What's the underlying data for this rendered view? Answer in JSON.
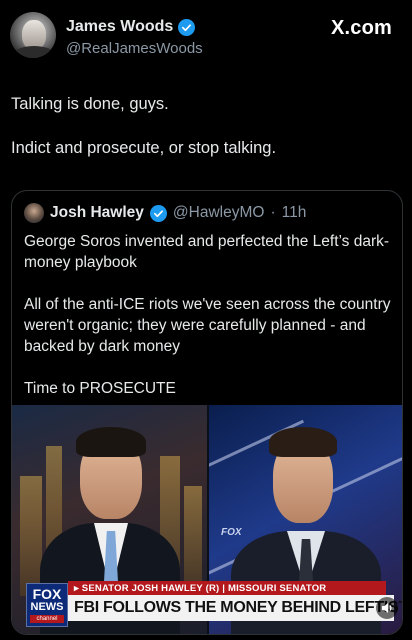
{
  "author": {
    "name": "James Woods",
    "handle": "@RealJamesWoods"
  },
  "brand": {
    "label": "X.com"
  },
  "tweet": {
    "lines": [
      "Talking is done, guys.",
      "Indict and prosecute, or stop talking."
    ]
  },
  "quote": {
    "name": "Josh Hawley",
    "handle": "@HawleyMO",
    "separator": "·",
    "time": "11h",
    "paragraphs": [
      "George Soros invented and perfected the Left’s dark-money playbook",
      "All of the anti-ICE riots we've seen across the country weren't organic; they were carefully planned - and backed by dark money",
      "Time to PROSECUTE"
    ]
  },
  "video": {
    "watermark": "FOX",
    "chyron_top": "▸ SENATOR JOSH HAWLEY (R) | MISSOURI SENATOR",
    "chyron_main": "FBI FOLLOWS THE MONEY BEHIND LEFTIST VIOLENCE",
    "logo": {
      "line1": "FOX",
      "line2": "NEWS",
      "line3": "channel"
    }
  },
  "colors": {
    "background": "#000000",
    "verified": "#1d9bf0",
    "muted_text": "#8b98a5",
    "chyron_red": "#b3191c"
  },
  "icons": {
    "verified": "verified-badge-icon",
    "sound": "speaker-icon"
  }
}
